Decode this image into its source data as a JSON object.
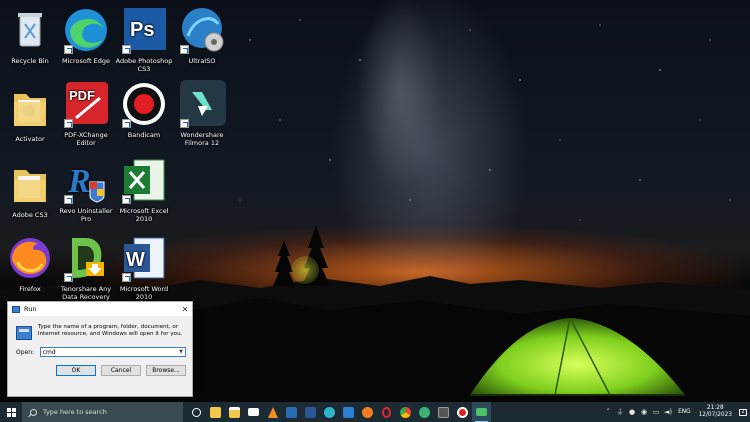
{
  "desktop": {
    "icons": [
      {
        "label": "Recycle Bin",
        "icon": "recycle-bin-icon"
      },
      {
        "label": "Microsoft Edge",
        "icon": "edge-icon"
      },
      {
        "label": "Adobe Photoshop CS3",
        "icon": "photoshop-icon"
      },
      {
        "label": "UltraISO",
        "icon": "ultraiso-icon"
      },
      {
        "label": "Activator",
        "icon": "folder-icon"
      },
      {
        "label": "PDF-XChange Editor",
        "icon": "pdf-icon"
      },
      {
        "label": "Bandicam",
        "icon": "bandicam-icon"
      },
      {
        "label": "Wondershare Filmora 12",
        "icon": "filmora-icon"
      },
      {
        "label": "Adobe CS3",
        "icon": "folder-icon"
      },
      {
        "label": "Revo Uninstaller Pro",
        "icon": "revo-icon"
      },
      {
        "label": "Microsoft Excel 2010",
        "icon": "excel-icon"
      },
      {
        "label": "Firefox",
        "icon": "firefox-icon"
      },
      {
        "label": "Tenorshare Any Data Recovery Pro",
        "icon": "tenorshare-icon"
      },
      {
        "label": "Microsoft Word 2010",
        "icon": "word-icon"
      }
    ]
  },
  "run_dialog": {
    "title": "Run",
    "description": "Type the name of a program, folder, document, or Internet resource, and Windows will open it for you.",
    "open_label": "Open:",
    "input_value": "cmd",
    "ok_label": "OK",
    "cancel_label": "Cancel",
    "browse_label": "Browse..."
  },
  "taskbar": {
    "search_placeholder": "Type here to search",
    "apps": [
      {
        "icon": "task-view-icon",
        "color": "#ffffff"
      },
      {
        "icon": "file-explorer-icon",
        "color": "#f2c94c"
      },
      {
        "icon": "store-icon",
        "color": "#f2c94c"
      },
      {
        "icon": "mail-icon",
        "color": "#ffffff"
      },
      {
        "icon": "vlc-icon",
        "color": "#f28c1e"
      },
      {
        "icon": "photoshop-icon",
        "color": "#2b6db5"
      },
      {
        "icon": "word-icon",
        "color": "#2b5797"
      },
      {
        "icon": "edge-icon",
        "color": "#2fb6c8"
      },
      {
        "icon": "photos-icon",
        "color": "#2f7fd6"
      },
      {
        "icon": "firefox-icon",
        "color": "#f57c23"
      },
      {
        "icon": "opera-icon",
        "color": "#e22434"
      },
      {
        "icon": "chrome-icon",
        "color": "#4caf50"
      },
      {
        "icon": "edge-dev-icon",
        "color": "#3bb273"
      },
      {
        "icon": "media-icon",
        "color": "#888888"
      },
      {
        "icon": "bandicam-icon",
        "color": "#e02424"
      },
      {
        "icon": "run-app-icon",
        "color": "#4cc26b"
      }
    ],
    "lang": "ENG",
    "time": "21:28",
    "date": "12/07/2023",
    "notification_count": "2"
  }
}
